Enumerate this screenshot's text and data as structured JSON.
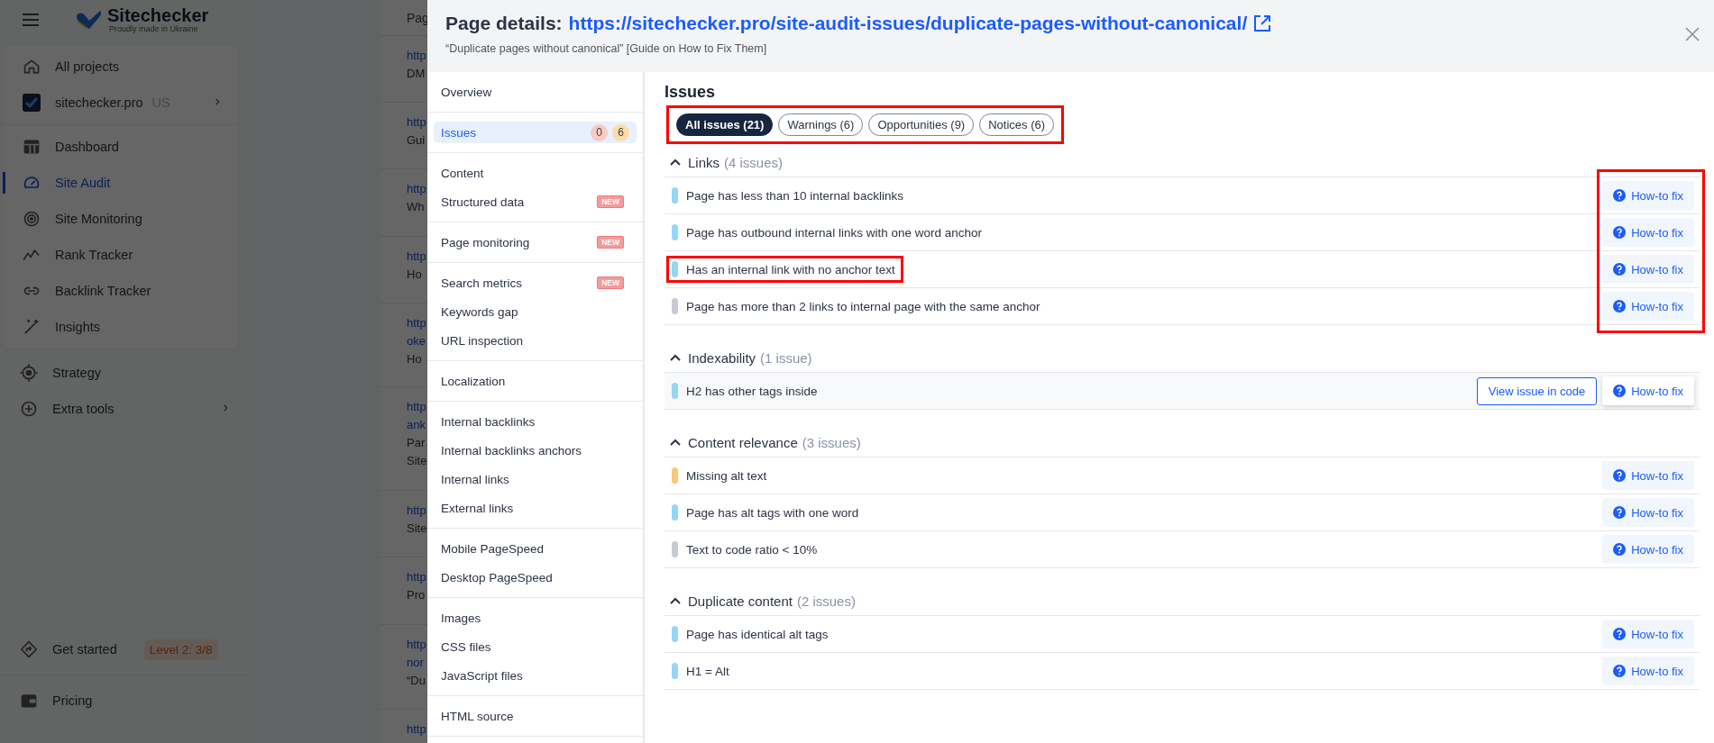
{
  "sidebar": {
    "logo": {
      "name": "Sitechecker",
      "tagline": "Proudly made in Ukraine"
    },
    "projects": [
      {
        "label": "All projects",
        "kind": "link"
      },
      {
        "label": "sitechecker.pro",
        "region": "US",
        "kind": "project"
      }
    ],
    "items": [
      {
        "label": "Dashboard",
        "selected": false
      },
      {
        "label": "Site Audit",
        "selected": true
      },
      {
        "label": "Site Monitoring",
        "selected": false
      },
      {
        "label": "Rank Tracker",
        "selected": false
      },
      {
        "label": "Backlink Tracker",
        "selected": false
      },
      {
        "label": "Insights",
        "selected": false
      }
    ],
    "tools": [
      {
        "label": "Strategy"
      },
      {
        "label": "Extra tools",
        "expandable": true
      }
    ],
    "get_started": {
      "label": "Get started",
      "badge": "Level 2: 3/8"
    },
    "pricing": {
      "label": "Pricing"
    }
  },
  "background_table": {
    "column_1": "Pag",
    "rows": [
      [
        "http",
        "DM"
      ],
      [
        "http",
        "Gui"
      ],
      [
        "http",
        "Wh"
      ],
      [
        "http",
        "Ho"
      ],
      [
        "http",
        "oke",
        "Ho"
      ],
      [
        "http",
        "ank",
        "Par",
        "Site"
      ],
      [
        "http",
        "Site"
      ],
      [
        "http",
        "Pro"
      ],
      [
        "http",
        "nor",
        "“Du"
      ],
      [
        "http"
      ]
    ]
  },
  "modal": {
    "title": "Page details:",
    "url": "https://sitechecker.pro/site-audit-issues/duplicate-pages-without-canonical/",
    "subtitle": "“Duplicate pages without canonical” [Guide on How to Fix Them]",
    "nav": [
      [
        {
          "label": "Overview",
          "selected": false
        }
      ],
      [
        {
          "label": "Issues",
          "selected": true,
          "counts": [
            {
              "text": "0",
              "color": "#f8c9c6"
            },
            {
              "text": "6",
              "color": "#fcdca8"
            }
          ]
        }
      ],
      [
        {
          "label": "Content",
          "selected": false
        },
        {
          "label": "Structured data",
          "selected": false,
          "tag": "NEW"
        }
      ],
      [
        {
          "label": "Page monitoring",
          "selected": false,
          "tag": "NEW"
        }
      ],
      [
        {
          "label": "Search metrics",
          "selected": false,
          "tag": "NEW"
        },
        {
          "label": "Keywords gap",
          "selected": false
        },
        {
          "label": "URL inspection",
          "selected": false
        }
      ],
      [
        {
          "label": "Localization",
          "selected": false
        }
      ],
      [
        {
          "label": "Internal backlinks",
          "selected": false
        },
        {
          "label": "Internal backlinks anchors",
          "selected": false
        },
        {
          "label": "Internal links",
          "selected": false
        },
        {
          "label": "External links",
          "selected": false
        }
      ],
      [
        {
          "label": "Mobile PageSpeed",
          "selected": false
        },
        {
          "label": "Desktop PageSpeed",
          "selected": false
        }
      ],
      [
        {
          "label": "Images",
          "selected": false
        },
        {
          "label": "CSS files",
          "selected": false
        },
        {
          "label": "JavaScript files",
          "selected": false
        }
      ],
      [
        {
          "label": "HTML source",
          "selected": false
        }
      ]
    ],
    "issues": {
      "title": "Issues",
      "filters_highlighted": true,
      "filters": [
        {
          "label": "All issues (21)",
          "selected": true
        },
        {
          "label": "Warnings (6)",
          "selected": false
        },
        {
          "label": "Opportunities (9)",
          "selected": false
        },
        {
          "label": "Notices (6)",
          "selected": false
        }
      ],
      "groups": [
        {
          "name": "Links",
          "count": "(4 issues)",
          "expanded": true,
          "fix_highlighted": true,
          "issues": [
            {
              "text": "Page has less than 10 internal backlinks",
              "color": "#93d6f6",
              "highlighted": false,
              "hovered": false,
              "fix": "How-to fix"
            },
            {
              "text": "Page has outbound internal links with one word anchor",
              "color": "#93d6f6",
              "highlighted": false,
              "hovered": false,
              "fix": "How-to fix"
            },
            {
              "text": "Has an internal link with no anchor text",
              "color": "#93d6f6",
              "highlighted": true,
              "hovered": false,
              "fix": "How-to fix"
            },
            {
              "text": "Page has more than 2 links to internal page with the same anchor",
              "color": "#c6cad5",
              "highlighted": false,
              "hovered": false,
              "fix": "How-to fix"
            }
          ]
        },
        {
          "name": "Indexability",
          "count": "(1 issue)",
          "expanded": true,
          "fix_highlighted": false,
          "issues": [
            {
              "text": "H2 has other tags inside",
              "color": "#93d6f6",
              "highlighted": false,
              "hovered": true,
              "view_code": "View issue in code",
              "fix": "How-to fix"
            }
          ]
        },
        {
          "name": "Content relevance",
          "count": "(3 issues)",
          "expanded": true,
          "fix_highlighted": false,
          "issues": [
            {
              "text": "Missing alt text",
              "color": "#fcc77c",
              "highlighted": false,
              "hovered": false,
              "fix": "How-to fix"
            },
            {
              "text": "Page has alt tags with one word",
              "color": "#93d6f6",
              "highlighted": false,
              "hovered": false,
              "fix": "How-to fix"
            },
            {
              "text": "Text to code ratio < 10%",
              "color": "#c6cad5",
              "highlighted": false,
              "hovered": false,
              "fix": "How-to fix"
            }
          ]
        },
        {
          "name": "Duplicate content",
          "count": "(2 issues)",
          "expanded": true,
          "fix_highlighted": false,
          "issues": [
            {
              "text": "Page has identical alt tags",
              "color": "#93d6f6",
              "highlighted": false,
              "hovered": false,
              "fix": "How-to fix"
            },
            {
              "text": "H1 = Alt",
              "color": "#93d6f6",
              "highlighted": false,
              "hovered": false,
              "fix": "How-to fix"
            }
          ]
        }
      ]
    }
  }
}
